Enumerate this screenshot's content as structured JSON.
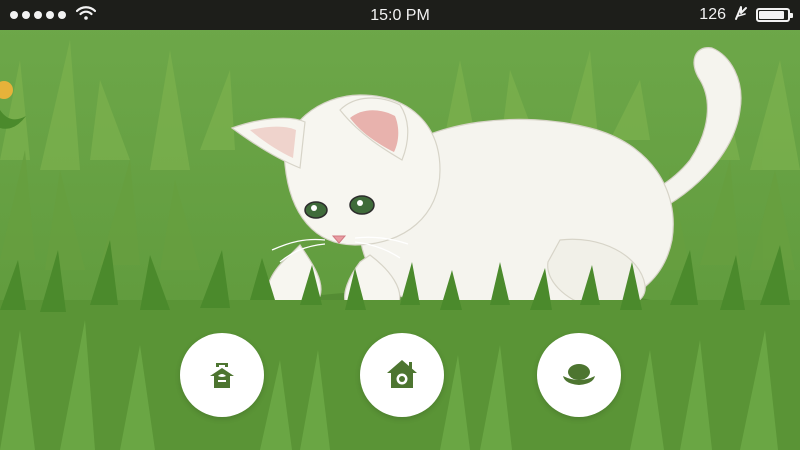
{
  "status_bar": {
    "time": "15:0 PM",
    "step_count": "126",
    "signal_dots": 5,
    "icons": [
      "signal-dots-icon",
      "wifi-icon",
      "pedometer-icon",
      "battery-icon"
    ],
    "battery_level": 0.9
  },
  "nav_buttons": [
    {
      "icon": "pet-carrier-icon"
    },
    {
      "icon": "home-camera-icon"
    },
    {
      "icon": "pet-bowl-icon"
    }
  ],
  "colors": {
    "grass_base": "#5f9a3a",
    "grass_dark": "#4b8a2c",
    "grass_light": "#7db24e",
    "status_bar": "#1d1e1a",
    "kitten_fur": "#f5f4ee",
    "ear_inner": "#e8b2ad",
    "eye": "#3f6b3a",
    "nose": "#e99aa0",
    "icon": "#4d7530",
    "button_bg": "#ffffff"
  }
}
